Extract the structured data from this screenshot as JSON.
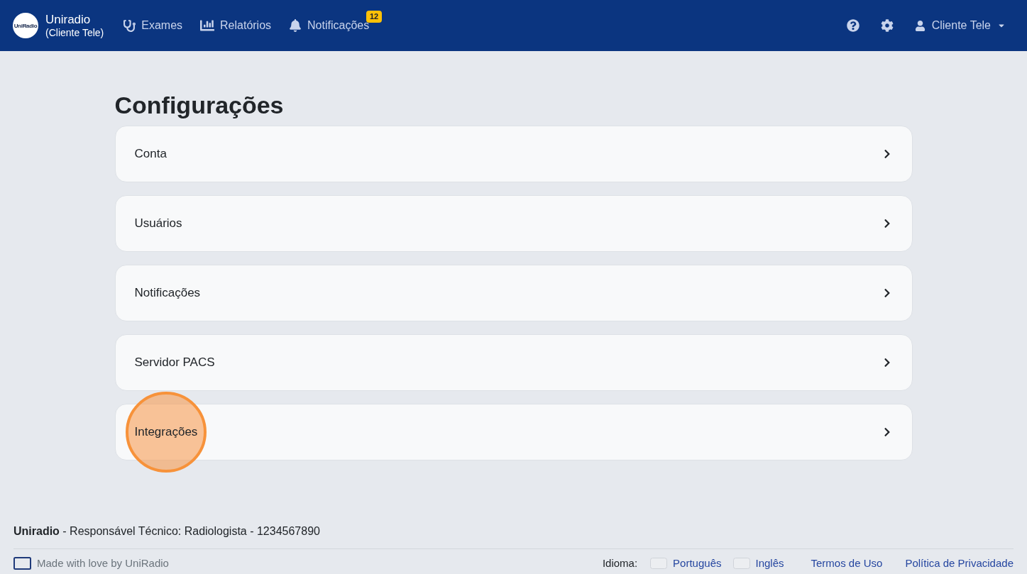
{
  "navbar": {
    "logo_text": "UniRadio",
    "brand": "Uniradio",
    "brand_subtitle": "(Cliente Tele)",
    "links": [
      {
        "kind": "exams",
        "label": "Exames"
      },
      {
        "kind": "reports",
        "label": "Relatórios"
      },
      {
        "kind": "notifications",
        "label": "Notificações",
        "badge": "12"
      }
    ],
    "user_name": "Cliente Tele"
  },
  "page": {
    "title": "Configurações",
    "items": [
      {
        "label": "Conta",
        "highlighted": false
      },
      {
        "label": "Usuários",
        "highlighted": false
      },
      {
        "label": "Notificações",
        "highlighted": false
      },
      {
        "label": "Servidor PACS",
        "highlighted": false
      },
      {
        "label": "Integrações",
        "highlighted": true
      }
    ]
  },
  "footer": {
    "credits": "**Uniradio** - Responsável Técnico: Radiologista - 1234567890",
    "made_with": "Made with love by UniRadio",
    "language_label": "Idioma:",
    "languages": [
      {
        "label": "Português"
      },
      {
        "label": "Inglês"
      }
    ],
    "links": [
      "Termos de Uso",
      "Política de Privacidade"
    ]
  }
}
